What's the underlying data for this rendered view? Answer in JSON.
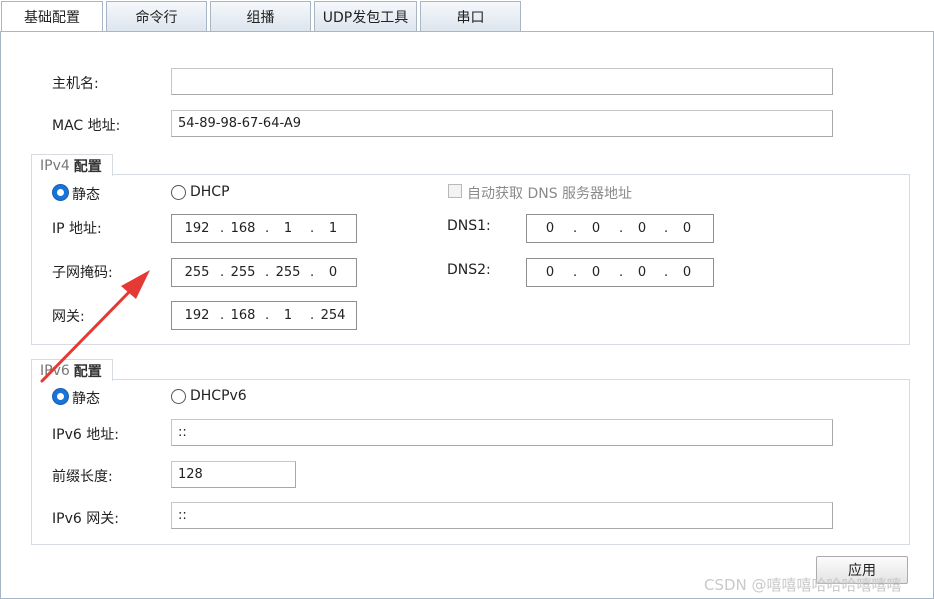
{
  "tabs": [
    "基础配置",
    "命令行",
    "组播",
    "UDP发包工具",
    "串口"
  ],
  "basic": {
    "hostname_label": "主机名:",
    "hostname_value": "",
    "mac_label": "MAC 地址:",
    "mac_value": "54-89-98-67-64-A9"
  },
  "ipv4": {
    "group_title_prefix": "IPv4",
    "group_title": "配置",
    "static_label": "静态",
    "dhcp_label": "DHCP",
    "auto_dns_label": "自动获取 DNS 服务器地址",
    "ip_label": "IP 地址:",
    "ip": [
      "192",
      "168",
      "1",
      "1"
    ],
    "mask_label": "子网掩码:",
    "mask": [
      "255",
      "255",
      "255",
      "0"
    ],
    "gateway_label": "网关:",
    "gateway": [
      "192",
      "168",
      "1",
      "254"
    ],
    "dns1_label": "DNS1:",
    "dns1": [
      "0",
      "0",
      "0",
      "0"
    ],
    "dns2_label": "DNS2:",
    "dns2": [
      "0",
      "0",
      "0",
      "0"
    ]
  },
  "ipv6": {
    "group_title_prefix": "IPv6",
    "group_title": "配置",
    "static_label": "静态",
    "dhcp_label": "DHCPv6",
    "ip_label": "IPv6 地址:",
    "ip_value": "::",
    "prefix_label": "前缀长度:",
    "prefix_value": "128",
    "gateway_label": "IPv6 网关:",
    "gateway_value": "::"
  },
  "apply_label": "应用",
  "watermark": "CSDN @嘻嘻嘻哈哈哈嘻嘻嘻",
  "colors": {
    "accent": "#1a73d6",
    "arrow": "#e53935"
  }
}
